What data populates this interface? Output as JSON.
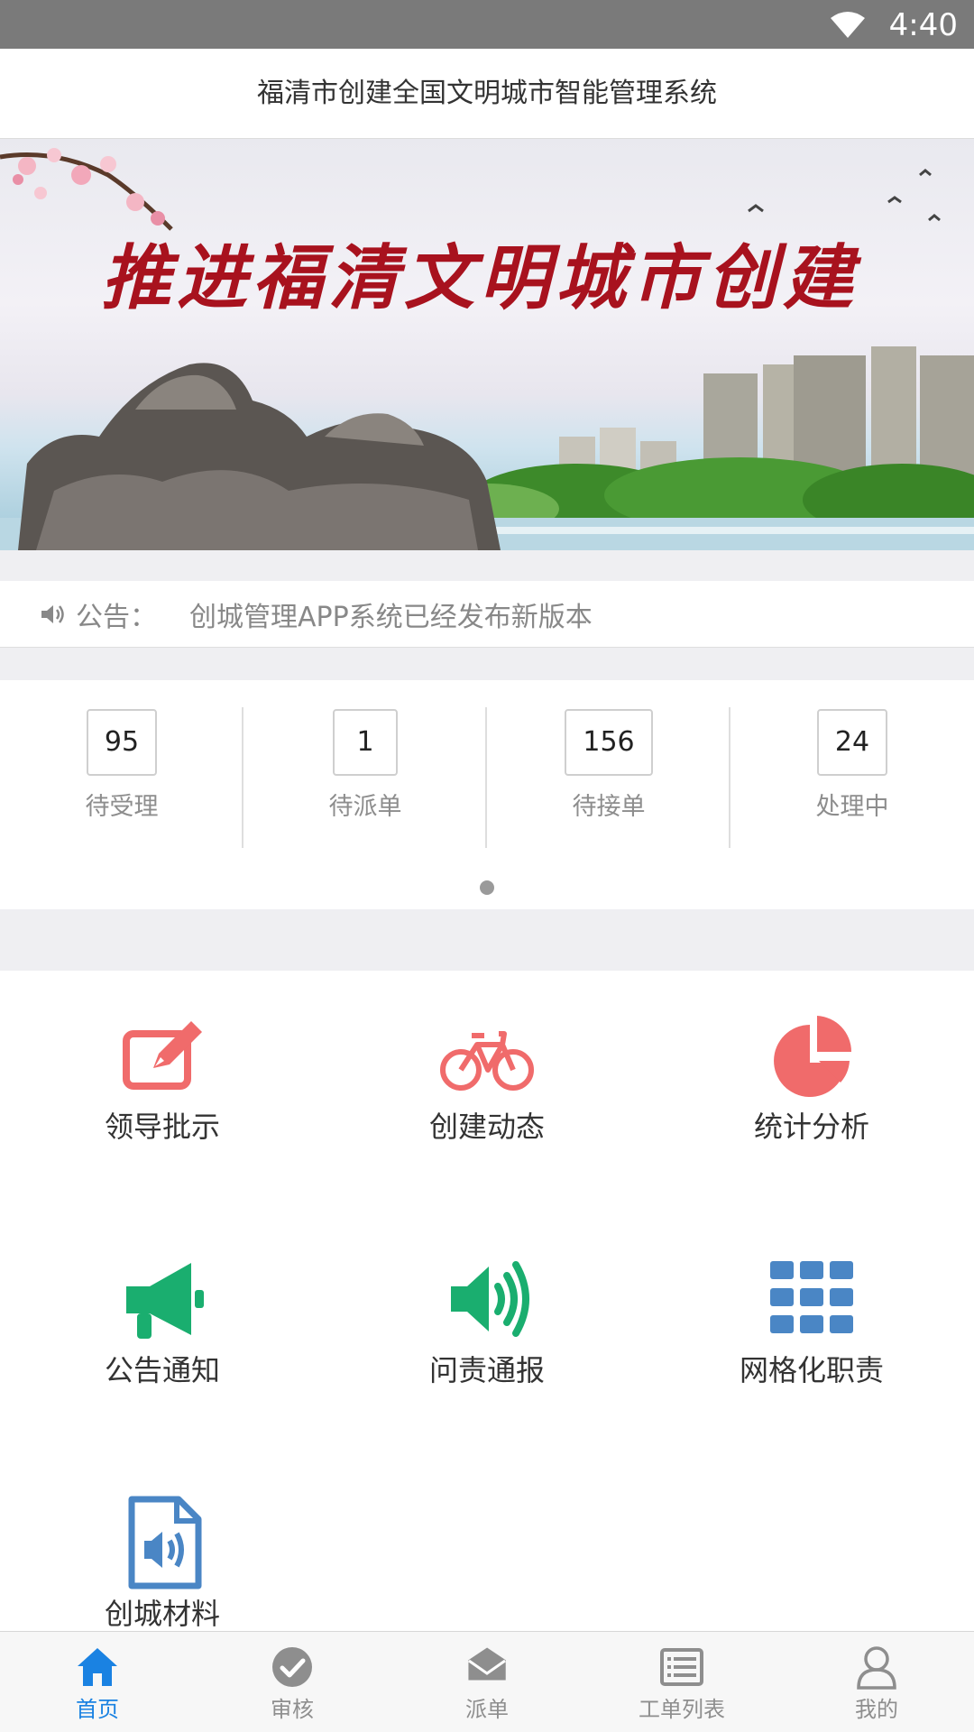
{
  "status_bar": {
    "time": "4:40",
    "wifi_icon": "wifi-icon"
  },
  "header": {
    "title": "福清市创建全国文明城市智能管理系统"
  },
  "banner": {
    "slogan": "推进福清文明城市创建"
  },
  "notice": {
    "icon": "speaker-icon",
    "label": "公告：",
    "text": "创城管理APP系统已经发布新版本"
  },
  "stats": [
    {
      "value": "95",
      "label": "待受理"
    },
    {
      "value": "1",
      "label": "待派单"
    },
    {
      "value": "156",
      "label": "待接单"
    },
    {
      "value": "24",
      "label": "处理中"
    }
  ],
  "menu": [
    {
      "label": "领导批示",
      "icon": "edit-icon",
      "color": "#f06b6b"
    },
    {
      "label": "创建动态",
      "icon": "bicycle-icon",
      "color": "#f06b6b"
    },
    {
      "label": "统计分析",
      "icon": "pie-chart-icon",
      "color": "#f06b6b"
    },
    {
      "label": "公告通知",
      "icon": "megaphone-icon",
      "color": "#1aae6f"
    },
    {
      "label": "问责通报",
      "icon": "volume-icon",
      "color": "#1aae6f"
    },
    {
      "label": "网格化职责",
      "icon": "grid-icon",
      "color": "#4a86c5"
    },
    {
      "label": "创城材料",
      "icon": "audio-file-icon",
      "color": "#4a86c5"
    }
  ],
  "tabbar": [
    {
      "label": "首页",
      "icon": "home-icon",
      "active": true
    },
    {
      "label": "审核",
      "icon": "check-circle-icon",
      "active": false
    },
    {
      "label": "派单",
      "icon": "inbox-icon",
      "active": false
    },
    {
      "label": "工单列表",
      "icon": "list-icon",
      "active": false
    },
    {
      "label": "我的",
      "icon": "user-icon",
      "active": false
    }
  ],
  "colors": {
    "accent": "#1a82e2",
    "red": "#f06b6b",
    "green": "#1aae6f",
    "blue": "#4a86c5"
  }
}
